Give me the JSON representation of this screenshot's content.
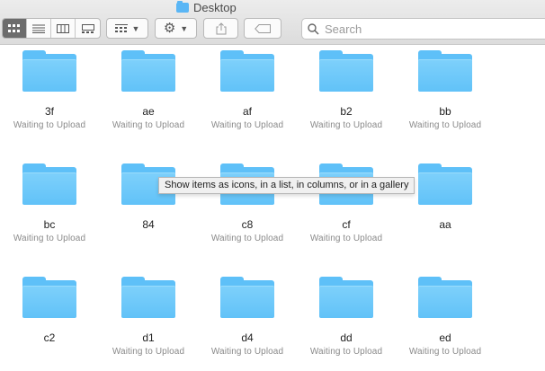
{
  "window": {
    "title": "Desktop"
  },
  "toolbar": {
    "view_buttons": [
      {
        "icon": "icon-view-icon",
        "active": true
      },
      {
        "icon": "list-view-icon",
        "active": false
      },
      {
        "icon": "column-view-icon",
        "active": false
      },
      {
        "icon": "gallery-view-icon",
        "active": false
      }
    ],
    "group_by_icon": "group-by-icon",
    "action_icon": "gear-icon",
    "share_icon": "share-icon",
    "tag_icon": "tag-icon",
    "search": {
      "placeholder": "Search",
      "value": ""
    }
  },
  "tooltip": "Show items as icons, in a list, in columns, or in a gallery",
  "items": [
    {
      "name": "3f",
      "status": "Waiting to Upload"
    },
    {
      "name": "ae",
      "status": "Waiting to Upload"
    },
    {
      "name": "af",
      "status": "Waiting to Upload"
    },
    {
      "name": "b2",
      "status": "Waiting to Upload"
    },
    {
      "name": "bb",
      "status": "Waiting to Upload"
    },
    {
      "name": "bc",
      "status": "Waiting to Upload"
    },
    {
      "name": "84",
      "status": ""
    },
    {
      "name": "c8",
      "status": "Waiting to Upload"
    },
    {
      "name": "cf",
      "status": "Waiting to Upload"
    },
    {
      "name": "aa",
      "status": ""
    },
    {
      "name": "c2",
      "status": ""
    },
    {
      "name": "d1",
      "status": "Waiting to Upload"
    },
    {
      "name": "d4",
      "status": "Waiting to Upload"
    },
    {
      "name": "dd",
      "status": "Waiting to Upload"
    },
    {
      "name": "ed",
      "status": "Waiting to Upload"
    }
  ],
  "colors": {
    "folder": "#5ec0f8",
    "active_view": "#6c6c6c"
  }
}
